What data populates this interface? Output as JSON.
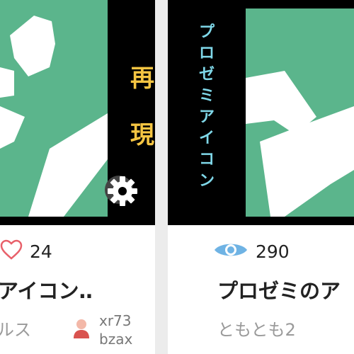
{
  "cards": [
    {
      "likes": "24",
      "title": "アイコン‥",
      "subtitle": "ルス",
      "user": {
        "line1": "xr73",
        "line2": "bzax"
      },
      "thumb_text": "再 現"
    },
    {
      "views": "290",
      "title": "プロゼミのア",
      "author": "ともとも2",
      "thumb_text": "プロゼミアイコン"
    }
  ],
  "colors": {
    "accent_green": "#5bb58c",
    "heart": "#e8606a",
    "eye": "#6fb3e4",
    "label_yellow": "#f5c542",
    "label_cyan": "#7fd7e8"
  }
}
